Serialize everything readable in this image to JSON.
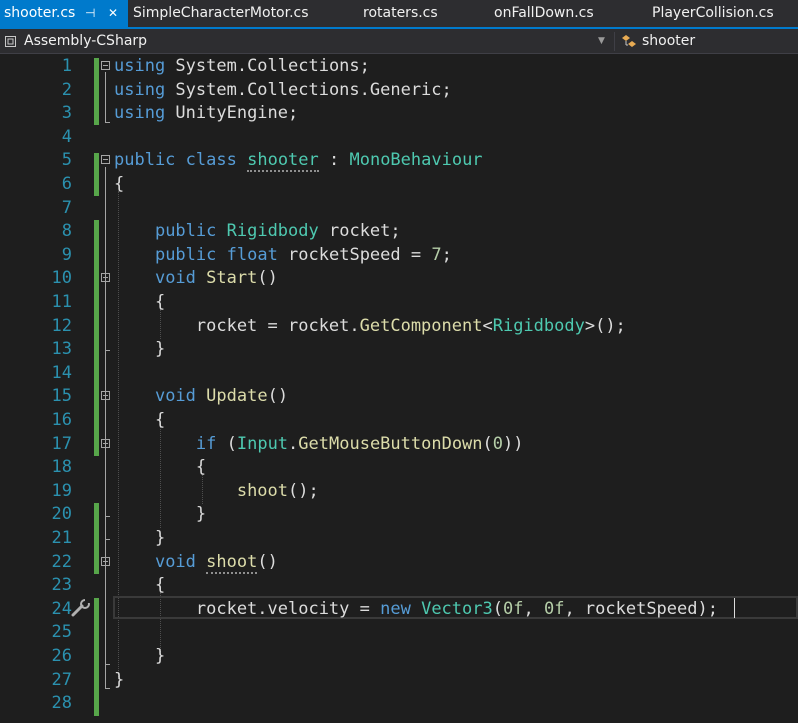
{
  "tabs": [
    {
      "label": "shooter.cs",
      "active": true,
      "pin_icon": "pin-icon",
      "close_icon": "close-icon",
      "pin_glyph": "⊣",
      "close_glyph": "✕"
    },
    {
      "label": "SimpleCharacterMotor.cs"
    },
    {
      "label": "rotaters.cs"
    },
    {
      "label": "onFallDown.cs"
    },
    {
      "label": "PlayerCollision.cs"
    }
  ],
  "navbar": {
    "project": "Assembly-CSharp",
    "project_icon": "csharp-project-icon",
    "type": "shooter",
    "type_icon": "class-icon",
    "dropdown_glyph": "▼"
  },
  "colors": {
    "keyword": "#569cd6",
    "type": "#4ec9b0",
    "method": "#dcdcaa",
    "number": "#b5cea8",
    "line_number": "#2b91af",
    "change_bar": "#57a64a",
    "accent": "#007acc"
  },
  "editor": {
    "gutter_icon": "quick-actions-wrench-icon",
    "lines": [
      {
        "n": "1",
        "fold": true,
        "tokens": [
          [
            "kw",
            "using"
          ],
          [
            "pl",
            " System.Collections;"
          ]
        ]
      },
      {
        "n": "2",
        "tokens": [
          [
            "kw",
            "using"
          ],
          [
            "pl",
            " System.Collections.Generic;"
          ]
        ]
      },
      {
        "n": "3",
        "tokens": [
          [
            "kw",
            "using"
          ],
          [
            "pl",
            " UnityEngine;"
          ]
        ]
      },
      {
        "n": "4",
        "tokens": []
      },
      {
        "n": "5",
        "fold": true,
        "tokens": [
          [
            "kw",
            "public"
          ],
          [
            "pl",
            " "
          ],
          [
            "kw",
            "class"
          ],
          [
            "pl",
            " "
          ],
          [
            "ty",
            "shooter",
            "squig"
          ],
          [
            "pl",
            " : "
          ],
          [
            "ty",
            "MonoBehaviour"
          ]
        ]
      },
      {
        "n": "6",
        "tokens": [
          [
            "pl",
            "{"
          ]
        ]
      },
      {
        "n": "7",
        "tokens": []
      },
      {
        "n": "8",
        "tokens": [
          [
            "pl",
            "    "
          ],
          [
            "kw",
            "public"
          ],
          [
            "pl",
            " "
          ],
          [
            "ty",
            "Rigidbody"
          ],
          [
            "pl",
            " rocket;"
          ]
        ]
      },
      {
        "n": "9",
        "tokens": [
          [
            "pl",
            "    "
          ],
          [
            "kw",
            "public"
          ],
          [
            "pl",
            " "
          ],
          [
            "kw",
            "float"
          ],
          [
            "pl",
            " rocketSpeed = "
          ],
          [
            "nu",
            "7"
          ],
          [
            "pl",
            ";"
          ]
        ]
      },
      {
        "n": "10",
        "fold": true,
        "tokens": [
          [
            "pl",
            "    "
          ],
          [
            "kw",
            "void"
          ],
          [
            "pl",
            " "
          ],
          [
            "me",
            "Start"
          ],
          [
            "pl",
            "()"
          ]
        ]
      },
      {
        "n": "11",
        "tokens": [
          [
            "pl",
            "    {"
          ]
        ]
      },
      {
        "n": "12",
        "tokens": [
          [
            "pl",
            "        rocket = rocket."
          ],
          [
            "me",
            "GetComponent"
          ],
          [
            "pl",
            "<"
          ],
          [
            "ty",
            "Rigidbody"
          ],
          [
            "pl",
            ">();"
          ]
        ]
      },
      {
        "n": "13",
        "tokens": [
          [
            "pl",
            "    }"
          ]
        ]
      },
      {
        "n": "14",
        "tokens": []
      },
      {
        "n": "15",
        "fold": true,
        "tokens": [
          [
            "pl",
            "    "
          ],
          [
            "kw",
            "void"
          ],
          [
            "pl",
            " "
          ],
          [
            "me",
            "Update"
          ],
          [
            "pl",
            "()"
          ]
        ]
      },
      {
        "n": "16",
        "tokens": [
          [
            "pl",
            "    {"
          ]
        ]
      },
      {
        "n": "17",
        "fold": true,
        "tokens": [
          [
            "pl",
            "        "
          ],
          [
            "kw",
            "if"
          ],
          [
            "pl",
            " ("
          ],
          [
            "ty",
            "Input"
          ],
          [
            "pl",
            "."
          ],
          [
            "me",
            "GetMouseButtonDown"
          ],
          [
            "pl",
            "("
          ],
          [
            "nu",
            "0"
          ],
          [
            "pl",
            "))"
          ]
        ]
      },
      {
        "n": "18",
        "tokens": [
          [
            "pl",
            "        {"
          ]
        ]
      },
      {
        "n": "19",
        "tokens": [
          [
            "pl",
            "            "
          ],
          [
            "me",
            "shoot"
          ],
          [
            "pl",
            "();"
          ]
        ]
      },
      {
        "n": "20",
        "tokens": [
          [
            "pl",
            "        }"
          ]
        ]
      },
      {
        "n": "21",
        "tokens": [
          [
            "pl",
            "    }"
          ]
        ]
      },
      {
        "n": "22",
        "fold": true,
        "tokens": [
          [
            "pl",
            "    "
          ],
          [
            "kw",
            "void"
          ],
          [
            "pl",
            " "
          ],
          [
            "me",
            "shoot",
            "squig"
          ],
          [
            "pl",
            "()"
          ]
        ]
      },
      {
        "n": "23",
        "tokens": [
          [
            "pl",
            "    {"
          ]
        ]
      },
      {
        "n": "24",
        "tokens": [
          [
            "pl",
            "        rocket.velocity = "
          ],
          [
            "kw",
            "new"
          ],
          [
            "pl",
            " "
          ],
          [
            "ty",
            "Vector3"
          ],
          [
            "pl",
            "("
          ],
          [
            "nu",
            "0f"
          ],
          [
            "pl",
            ", "
          ],
          [
            "nu",
            "0f"
          ],
          [
            "pl",
            ", rocketSpeed);"
          ]
        ]
      },
      {
        "n": "25",
        "tokens": []
      },
      {
        "n": "26",
        "tokens": [
          [
            "pl",
            "    }"
          ]
        ]
      },
      {
        "n": "27",
        "tokens": [
          [
            "pl",
            "}"
          ]
        ]
      },
      {
        "n": "28",
        "tokens": []
      }
    ]
  }
}
